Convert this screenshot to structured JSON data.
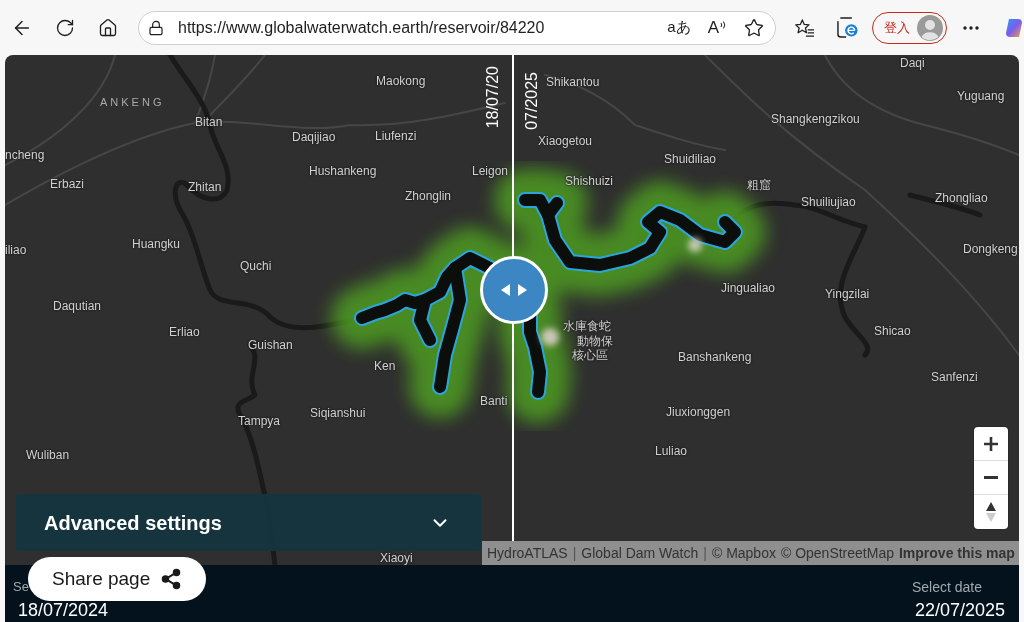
{
  "browser": {
    "url": "https://www.globalwaterwatch.earth/reservoir/84220",
    "translate_button": "aあ",
    "read_aloud_button": "A",
    "profile_button": "登入"
  },
  "map": {
    "district_labels": [
      "ANKENG"
    ],
    "place_labels": [
      "Daqi",
      "Maokong",
      "Shikantou",
      "Yuguang",
      "Bitan",
      "Shangkengzikou",
      "Daqijiao",
      "Liufenzi",
      "Xiaogetou",
      "ncheng",
      "Shuidiliao",
      "Hushankeng",
      "Leigon",
      "Erbazi",
      "Zhitan",
      "Shishuizi",
      "粗窟",
      "Zhonglin",
      "Shuiliujiao",
      "Zhongliao",
      "iliao",
      "Huangku",
      "Dongkeng",
      "Quchi",
      "Jingualiao",
      "Yingzilai",
      "Daqutian",
      "Erliao",
      "水庫食蛇",
      "Shicao",
      "Guishan",
      "動物保",
      "核心區",
      "Banshankeng",
      "Ken",
      "Sanfenzi",
      "Banti",
      "Siqianshui",
      "Jiuxionggen",
      "Tampya",
      "Wuliban",
      "Luliao",
      "Xiaoyi"
    ],
    "compare_dates": {
      "left": "18/07/20",
      "right": "07/2025"
    },
    "attribution": [
      {
        "kind": "link",
        "text": "HydroATLAS"
      },
      {
        "kind": "separator",
        "text": "|"
      },
      {
        "kind": "link",
        "text": "Global Dam Watch"
      },
      {
        "kind": "separator",
        "text": "|"
      },
      {
        "kind": "link",
        "text": "© Mapbox"
      },
      {
        "kind": "link",
        "text": "© OpenStreetMap"
      },
      {
        "kind": "feedback",
        "text": "Improve this map"
      }
    ]
  },
  "advanced_settings": {
    "title": "Advanced settings",
    "expanded": false
  },
  "share_button": {
    "label": "Share page"
  },
  "date_bar": {
    "start": {
      "label": "Se",
      "value": "18/07/2024"
    },
    "end": {
      "label": "Select date",
      "value": "22/07/2025"
    }
  }
}
